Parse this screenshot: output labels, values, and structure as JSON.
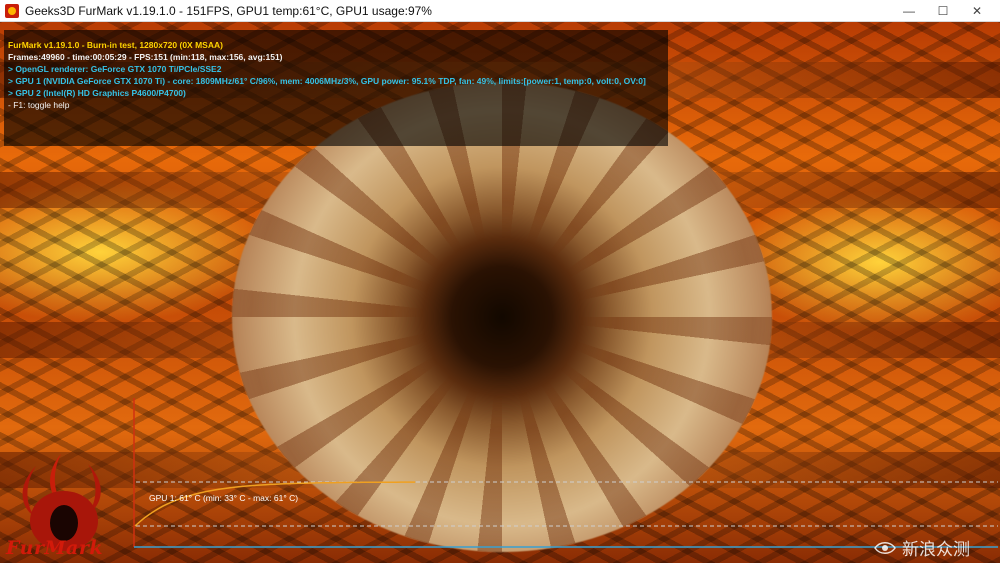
{
  "window": {
    "title": "Geeks3D FurMark v1.19.1.0 - 151FPS, GPU1 temp:61°C, GPU1 usage:97%",
    "minimize": "—",
    "maximize": "☐",
    "close": "✕"
  },
  "overlay": {
    "lines": [
      "FurMark v1.19.1.0 - Burn-in test, 1280x720 (0X MSAA)",
      "Frames:49960 - time:00:05:29 - FPS:151 (min:118, max:156, avg:151)",
      "> OpenGL renderer: GeForce GTX 1070 Ti/PCIe/SSE2",
      "> GPU 1 (NVIDIA GeForce GTX 1070 Ti) - core: 1809MHz/61° C/96%, mem: 4006MHz/3%, GPU power: 95.1% TDP, fan: 49%, limits:[power:1, temp:0, volt:0, OV:0]",
      "> GPU 2 (Intel(R) HD Graphics P4600/P4700)",
      "- F1: toggle help"
    ]
  },
  "graph": {
    "label": "GPU 1: 61° C (min: 33° C - max: 61° C)",
    "min_temp": 33,
    "max_temp": 61,
    "current_temp": 61,
    "line_color": "#f0a020"
  },
  "logo": {
    "word": "FurMark"
  },
  "watermark": {
    "text": "新浪众测"
  }
}
